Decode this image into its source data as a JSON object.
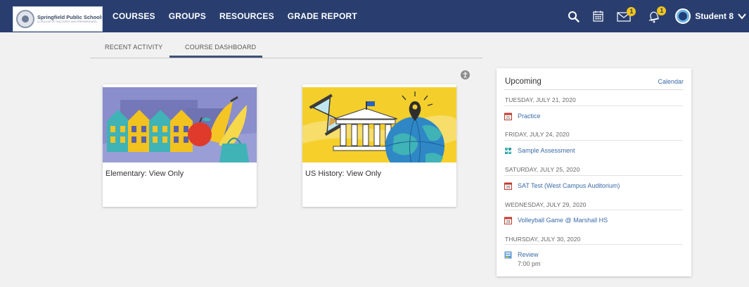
{
  "brand": {
    "name": "Springfield Public Schools",
    "tagline": "A COLLEGE OF DISCOVERY AND PREPAREDNESS"
  },
  "nav": {
    "items": [
      "COURSES",
      "GROUPS",
      "RESOURCES",
      "GRADE REPORT"
    ]
  },
  "header_right": {
    "messages_badge": "1",
    "notifications_badge": "1",
    "user_name": "Student 8"
  },
  "tabs": {
    "recent": "RECENT ACTIVITY",
    "dashboard": "COURSE DASHBOARD",
    "active": "COURSE DASHBOARD"
  },
  "courses": [
    {
      "title": "Elementary: View Only"
    },
    {
      "title": "US History: View Only"
    }
  ],
  "upcoming": {
    "heading": "Upcoming",
    "calendar_link": "Calendar",
    "groups": [
      {
        "date": "TUESDAY, JULY 21, 2020",
        "events": [
          {
            "icon": "calendar-date-icon",
            "day": "21",
            "label": "Practice"
          }
        ]
      },
      {
        "date": "FRIDAY, JULY 24, 2020",
        "events": [
          {
            "icon": "assessment-icon",
            "label": "Sample Assessment"
          }
        ]
      },
      {
        "date": "SATURDAY, JULY 25, 2020",
        "events": [
          {
            "icon": "calendar-date-icon",
            "day": "25",
            "label": "SAT Test (West Campus Auditorium)"
          }
        ]
      },
      {
        "date": "WEDNESDAY, JULY 29, 2020",
        "events": [
          {
            "icon": "calendar-date-icon",
            "day": "29",
            "label": "Volleyball Game @ Marshall HS"
          }
        ]
      },
      {
        "date": "THURSDAY, JULY 30, 2020",
        "events": [
          {
            "icon": "assignment-icon",
            "label": "Review",
            "time": "7:00 pm"
          }
        ]
      }
    ]
  },
  "colors": {
    "topbar": "#293e6f",
    "badge": "#f3c41a",
    "link": "#3b6aa8",
    "page_bg": "#f1f1f1"
  }
}
